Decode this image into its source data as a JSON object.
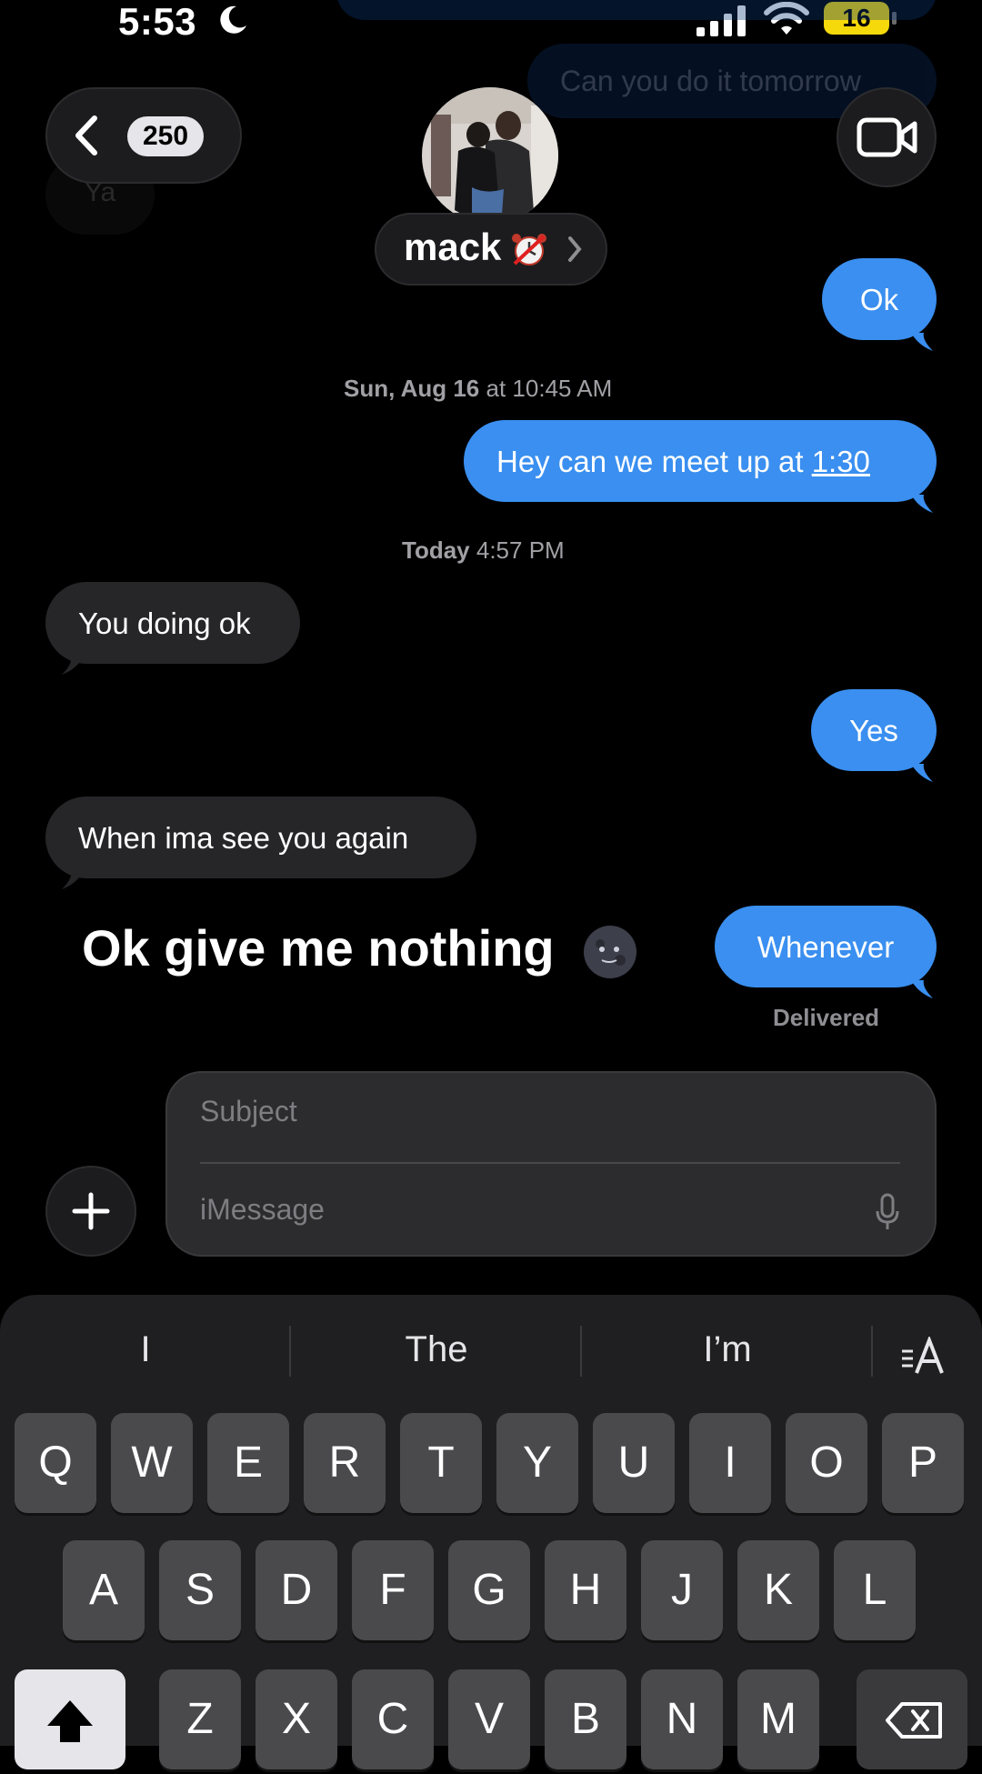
{
  "status_bar": {
    "time": "5:53",
    "battery": "16"
  },
  "background_messages": {
    "top_right": "Can you do it tomorrow",
    "left": "Ya"
  },
  "header": {
    "back_count": "250",
    "contact_name": "mack"
  },
  "messages": [
    {
      "text": "Ok"
    },
    {
      "timestamp_bold": "Sun, Aug 16",
      "timestamp_light": " at 10:45 AM"
    },
    {
      "text_prefix": "Hey can we meet up at ",
      "text_link": "1:30"
    },
    {
      "timestamp_bold": "Today",
      "timestamp_light": " 4:57 PM"
    },
    {
      "text": "You doing ok"
    },
    {
      "text": "Yes"
    },
    {
      "text": "When ima see you again"
    },
    {
      "text": "Whenever"
    }
  ],
  "overlay_caption": "Ok give me nothing",
  "delivered_label": "Delivered",
  "compose": {
    "subject_placeholder": "Subject",
    "message_placeholder": "iMessage"
  },
  "keyboard": {
    "suggestions": [
      "I",
      "The",
      "I’m"
    ],
    "row1": [
      "Q",
      "W",
      "E",
      "R",
      "T",
      "Y",
      "U",
      "I",
      "O",
      "P"
    ],
    "row2": [
      "A",
      "S",
      "D",
      "F",
      "G",
      "H",
      "J",
      "K",
      "L"
    ],
    "row3": [
      "Z",
      "X",
      "C",
      "V",
      "B",
      "N",
      "M"
    ]
  },
  "colors": {
    "outgoing_bubble": "#3a8ff0",
    "incoming_bubble": "#262628",
    "battery": "#f5d90a"
  },
  "icons": [
    "moon-icon",
    "signal-icon",
    "wifi-icon",
    "back-chevron-icon",
    "video-camera-icon",
    "plus-icon",
    "mic-icon",
    "format-icon",
    "shift-icon",
    "delete-icon",
    "new-moon-face-icon"
  ]
}
